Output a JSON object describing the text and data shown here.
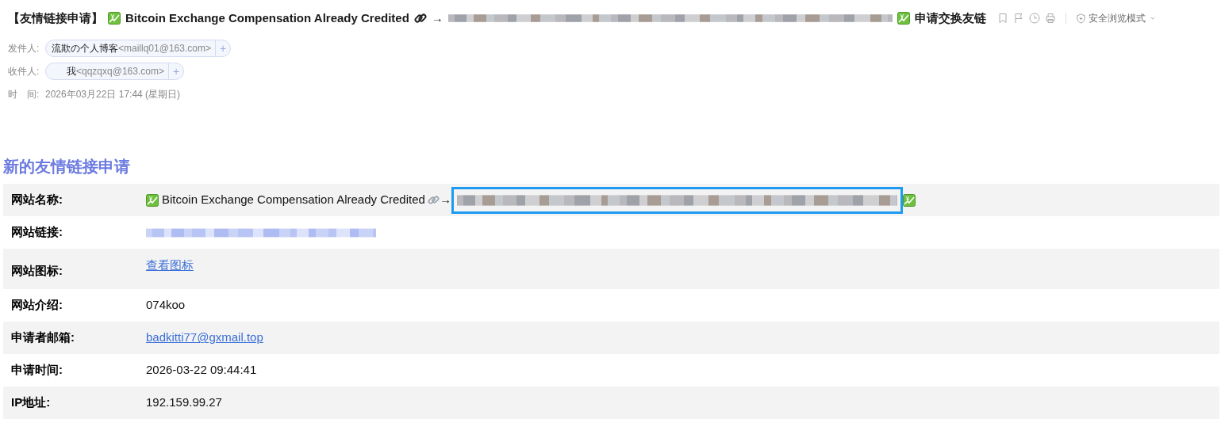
{
  "subject": {
    "prefix": "【友情链接申请】",
    "name": "Bitcoin Exchange Compensation Already Credited",
    "arrow": "→",
    "suffix": "申请交换友链"
  },
  "toolbar": {
    "safe_mode": "安全浏览模式"
  },
  "header_fields": [
    {
      "label": "发件人:",
      "name": "流欺の个人博客",
      "address": "<maillq01@163.com>",
      "add": "+"
    },
    {
      "label": "收件人:",
      "name": "我",
      "address": "<qqzqxq@163.com>",
      "add": "+"
    }
  ],
  "time": {
    "label": "时　间:",
    "value": "2026年03月22日 17:44 (星期日)"
  },
  "heading": "新的友情链接申请",
  "rows": [
    {
      "label": "网站名称:",
      "kind": "name",
      "value": "Bitcoin Exchange Compensation Already Credited",
      "arrow": "→",
      "highlighted": true
    },
    {
      "label": "网站链接:",
      "kind": "blurred"
    },
    {
      "label": "网站图标:",
      "kind": "link",
      "value": "查看图标"
    },
    {
      "label": "网站介绍:",
      "kind": "text",
      "value": "074koo"
    },
    {
      "label": "申请者邮箱:",
      "kind": "link",
      "value": "badkitti77@gxmail.top"
    },
    {
      "label": "申请时间:",
      "kind": "text",
      "value": "2026-03-22 09:44:41"
    },
    {
      "label": "IP地址:",
      "kind": "text",
      "value": "192.159.99.27"
    }
  ]
}
